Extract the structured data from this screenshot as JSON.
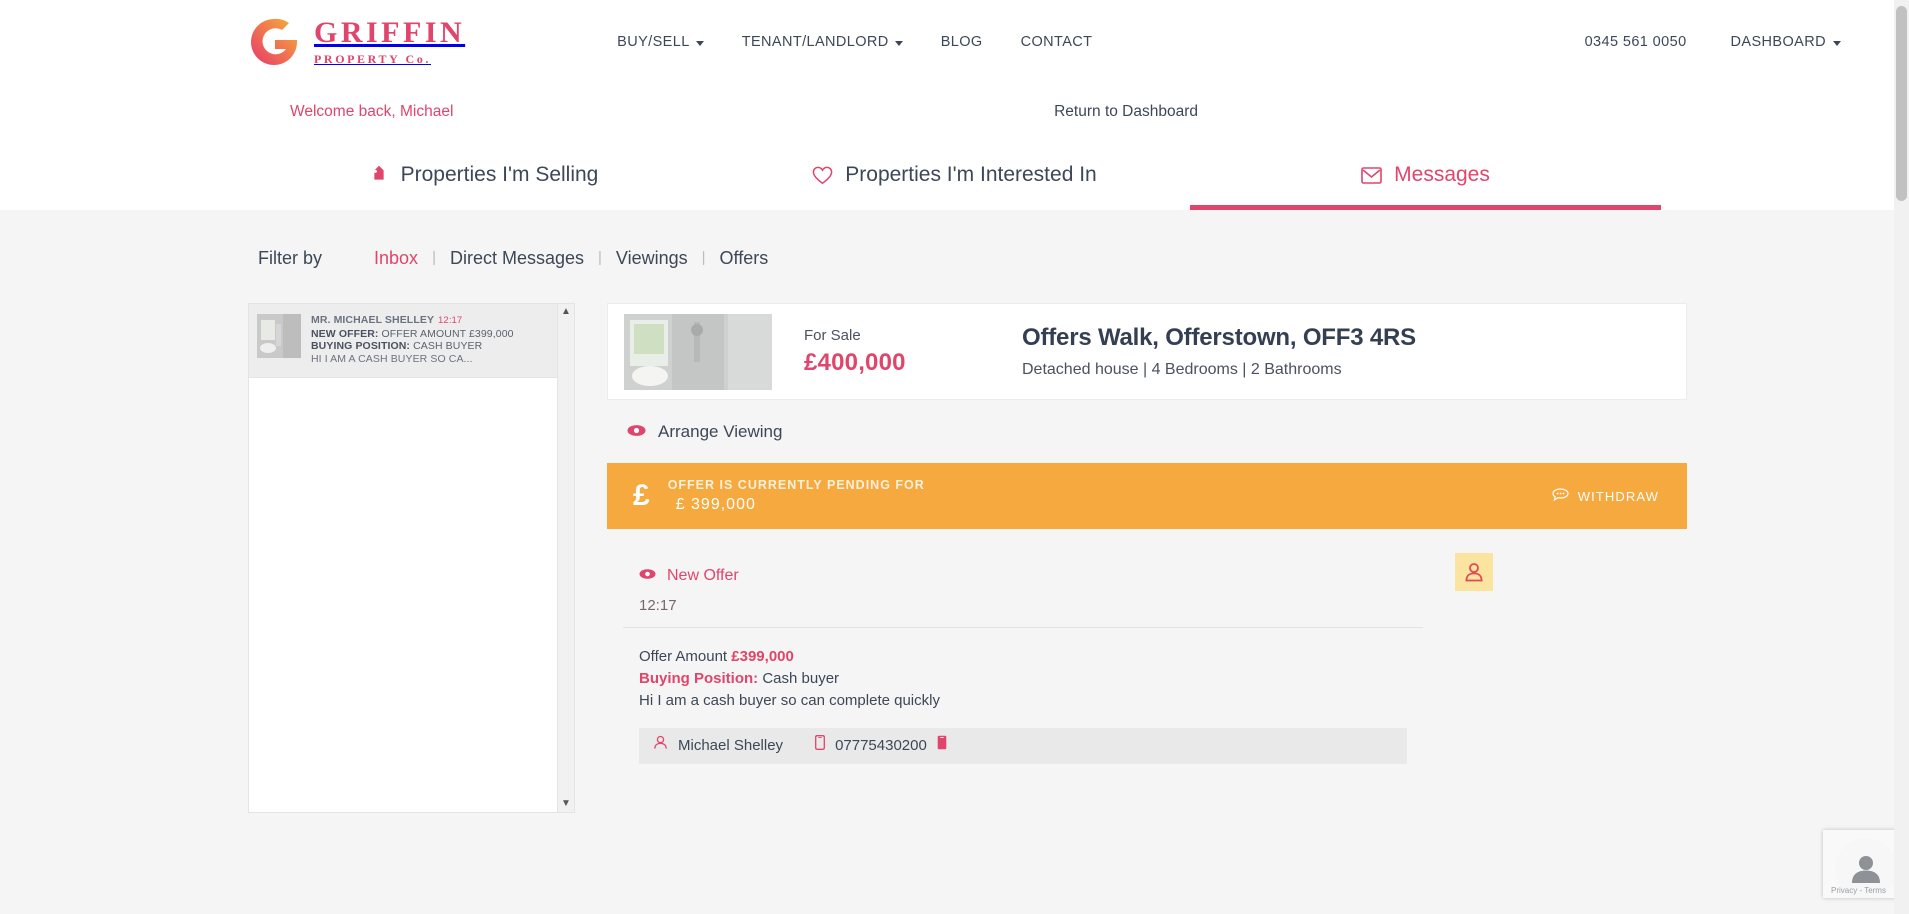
{
  "brand": {
    "name": "GRIFFIN",
    "tagline": "PROPERTY Co.",
    "accent": "#e0456b",
    "logo_icon": "griffin-g-logo"
  },
  "topnav": {
    "items": [
      {
        "label": "BUY/SELL",
        "has_caret": true
      },
      {
        "label": "TENANT/LANDLORD",
        "has_caret": true
      },
      {
        "label": "BLOG",
        "has_caret": false
      },
      {
        "label": "CONTACT",
        "has_caret": false
      }
    ],
    "phone": "0345 561 0050",
    "dashboard": {
      "label": "DASHBOARD",
      "has_caret": true
    }
  },
  "welcome": {
    "message": "Welcome back, Michael",
    "return_link": "Return to Dashboard"
  },
  "tabs": [
    {
      "label": "Properties I'm Selling",
      "icon": "tag-icon",
      "active": false
    },
    {
      "label": "Properties I'm Interested In",
      "icon": "heart-icon",
      "active": false
    },
    {
      "label": "Messages",
      "icon": "envelope-icon",
      "active": true
    }
  ],
  "filter": {
    "label": "Filter by",
    "options": [
      {
        "label": "Inbox",
        "active": true
      },
      {
        "label": "Direct Messages",
        "active": false
      },
      {
        "label": "Viewings",
        "active": false
      },
      {
        "label": "Offers",
        "active": false
      }
    ],
    "separator": "|"
  },
  "message_list": {
    "scroll_up_icon": "chevron-up-icon",
    "scroll_down_icon": "chevron-down-icon",
    "items": [
      {
        "sender": "MR. MICHAEL SHELLEY",
        "time": "12:17",
        "line2_key": "NEW OFFER:",
        "line2_value": "OFFER AMOUNT £399,000",
        "line3_key": "BUYING POSITION:",
        "line3_value": "CASH BUYER",
        "preview": "HI I AM A CASH BUYER SO CA...",
        "thumb": "property-thumbnail"
      }
    ]
  },
  "property": {
    "status": "For Sale",
    "price": "£400,000",
    "title": "Offers Walk, Offerstown, OFF3 4RS",
    "subtitle": "Detached house | 4 Bedrooms | 2 Bathrooms",
    "image_alt": "property-photo-bathroom"
  },
  "arrange_viewing": {
    "label": "Arrange Viewing",
    "icon": "eye-icon"
  },
  "pending_offer": {
    "currency_icon": "£",
    "headline": "OFFER IS CURRENTLY PENDING FOR",
    "amount": "£  399,000",
    "withdraw_label": "WITHDRAW",
    "withdraw_icon": "speech-bubble-icon",
    "background": "#f5a93f"
  },
  "thread": {
    "type_label": "New Offer",
    "type_icon": "eye-icon",
    "time": "12:17",
    "offer_amount_label": "Offer Amount",
    "offer_amount_value": "£399,000",
    "buying_position_label": "Buying Position:",
    "buying_position_value": "Cash buyer",
    "body": "Hi I am a cash buyer so can complete quickly",
    "contact_name": "Michael Shelley",
    "contact_phone": "07775430200",
    "person_icon": "person-icon",
    "phone_icon": "mobile-phone-icon",
    "avatar_icon": "person-icon"
  },
  "recaptcha": {
    "label": "Privacy - Terms",
    "icon": "person-avatar-icon"
  }
}
